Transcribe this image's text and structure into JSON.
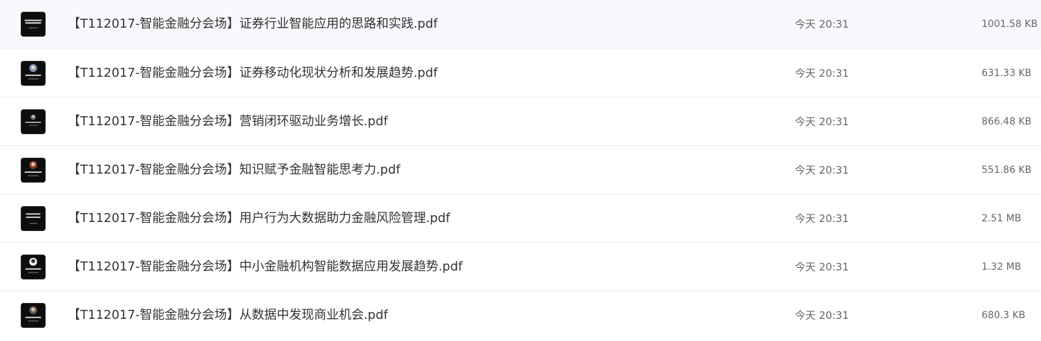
{
  "files": [
    {
      "name": "【T112017-智能金融分会场】证券行业智能应用的思路和实践.pdf",
      "date": "今天 20:31",
      "size": "1001.58 KB",
      "thumb_icon": "pdf-thumbnail-icon"
    },
    {
      "name": "【T112017-智能金融分会场】证券移动化现状分析和发展趋势.pdf",
      "date": "今天 20:31",
      "size": "631.33 KB",
      "thumb_icon": "pdf-thumbnail-icon"
    },
    {
      "name": "【T112017-智能金融分会场】营销闭环驱动业务增长.pdf",
      "date": "今天 20:31",
      "size": "866.48 KB",
      "thumb_icon": "pdf-thumbnail-icon"
    },
    {
      "name": "【T112017-智能金融分会场】知识赋予金融智能思考力.pdf",
      "date": "今天 20:31",
      "size": "551.86 KB",
      "thumb_icon": "pdf-thumbnail-icon"
    },
    {
      "name": "【T112017-智能金融分会场】用户行为大数据助力金融风险管理.pdf",
      "date": "今天 20:31",
      "size": "2.51 MB",
      "thumb_icon": "pdf-thumbnail-icon"
    },
    {
      "name": "【T112017-智能金融分会场】中小金融机构智能数据应用发展趋势.pdf",
      "date": "今天 20:31",
      "size": "1.32 MB",
      "thumb_icon": "pdf-thumbnail-icon"
    },
    {
      "name": "【T112017-智能金融分会场】从数据中发现商业机会.pdf",
      "date": "今天 20:31",
      "size": "680.3 KB",
      "thumb_icon": "pdf-thumbnail-icon"
    }
  ],
  "colors": {
    "row_divider": "#ececec",
    "name_text": "#333333",
    "meta_text": "#666666",
    "thumb_bg": "#0d0d0d"
  }
}
